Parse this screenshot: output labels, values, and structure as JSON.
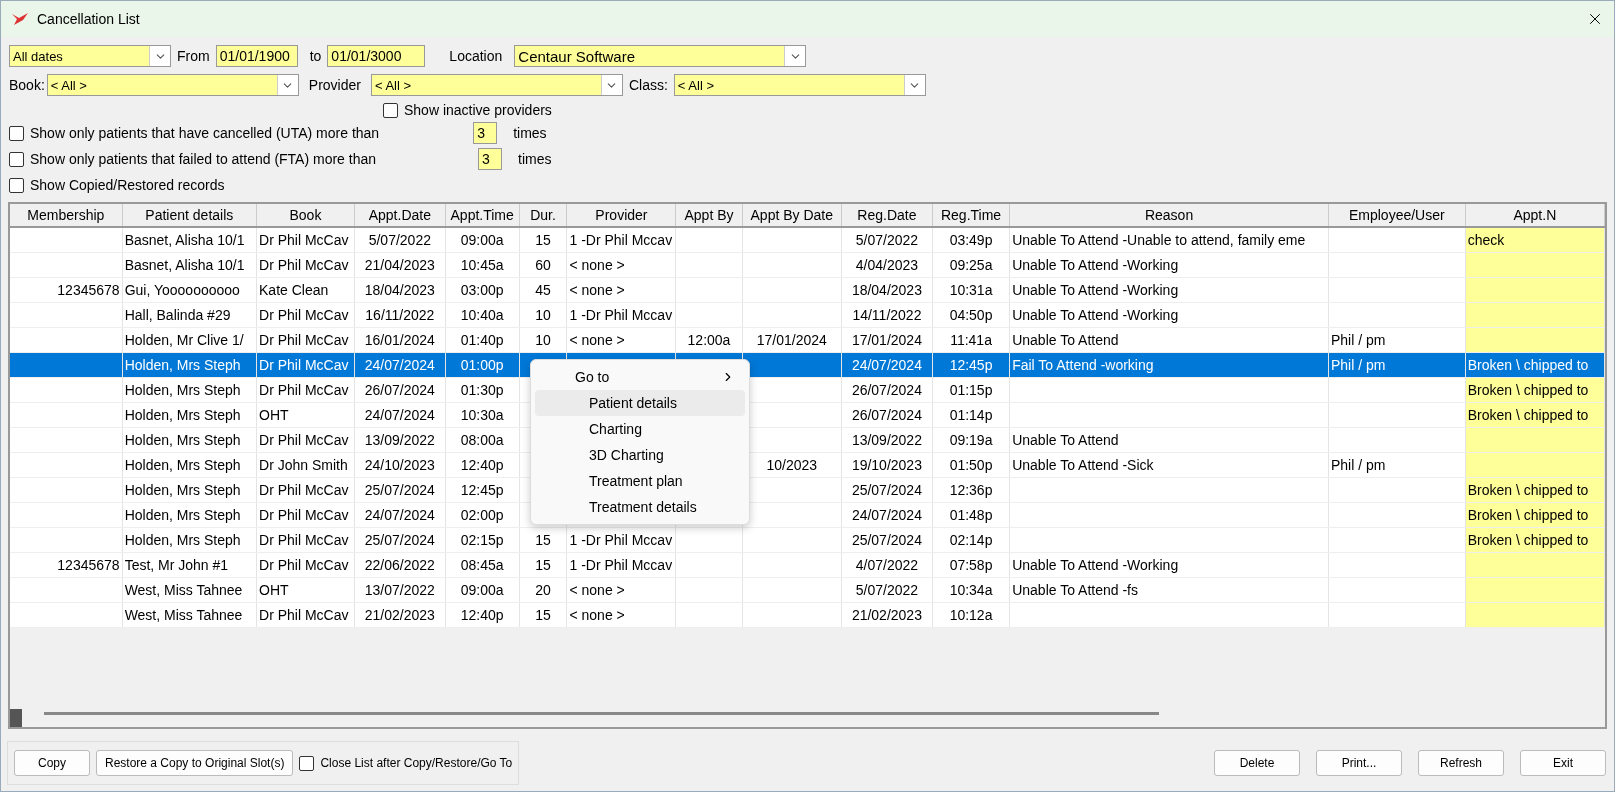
{
  "window": {
    "title": "Cancellation List"
  },
  "filters": {
    "date_range": {
      "value": "All dates"
    },
    "from_label": "From",
    "from": {
      "value": "01/01/1900"
    },
    "to_label": "to",
    "to": {
      "value": "01/01/3000"
    },
    "location_label": "Location",
    "location": {
      "value": "Centaur Software"
    },
    "book_label": "Book:",
    "book": {
      "value": "< All >"
    },
    "provider_label": "Provider",
    "provider": {
      "value": "< All >"
    },
    "class_label": "Class:",
    "class": {
      "value": "< All >"
    },
    "show_inactive": {
      "label": "Show inactive providers",
      "checked": false
    },
    "uta": {
      "label": "Show only patients that have cancelled (UTA) more than",
      "checked": false,
      "count": "3",
      "suffix": "times"
    },
    "fta": {
      "label": "Show only patients that failed to attend (FTA) more than",
      "checked": false,
      "count": "3",
      "suffix": "times"
    },
    "show_copied": {
      "label": "Show Copied/Restored records",
      "checked": false
    }
  },
  "table": {
    "columns": [
      "Membership",
      "Patient details",
      "Book",
      "Appt.Date",
      "Appt.Time",
      "Dur.",
      "Provider",
      "Appt By",
      "Appt By Date",
      "Reg.Date",
      "Reg.Time",
      "Reason",
      "Employee/User",
      "Appt.N"
    ],
    "rows": [
      {
        "selected": false,
        "cells": [
          null,
          "Basnet, Alisha 10/1",
          "Dr Phil McCav",
          "5/07/2022",
          "09:00a",
          "15",
          "1 -Dr Phil Mccav",
          null,
          null,
          "5/07/2022",
          "03:49p",
          "Unable To Attend -Unable to attend, family eme",
          null,
          "check"
        ]
      },
      {
        "selected": false,
        "cells": [
          null,
          "Basnet, Alisha 10/1",
          "Dr Phil McCav",
          "21/04/2023",
          "10:45a",
          "60",
          "< none >",
          null,
          null,
          "4/04/2023",
          "09:25a",
          "Unable To Attend -Working",
          null,
          null
        ]
      },
      {
        "selected": false,
        "cells": [
          "12345678",
          "Gui, Yoooooooooo",
          "Kate Clean",
          "18/04/2023",
          "03:00p",
          "45",
          "< none >",
          null,
          null,
          "18/04/2023",
          "10:31a",
          "Unable To Attend -Working",
          null,
          null
        ]
      },
      {
        "selected": false,
        "cells": [
          null,
          "Hall, Balinda #29",
          "Dr Phil McCav",
          "16/11/2022",
          "10:40a",
          "10",
          "1 -Dr Phil Mccav",
          null,
          null,
          "14/11/2022",
          "04:50p",
          "Unable To Attend -Working",
          null,
          null
        ]
      },
      {
        "selected": false,
        "cells": [
          null,
          "Holden, Mr Clive 1/",
          "Dr Phil McCav",
          "16/01/2024",
          "01:40p",
          "10",
          "< none >",
          "12:00a",
          "17/01/2024",
          "17/01/2024",
          "11:41a",
          "Unable To Attend",
          "Phil / pm",
          null
        ]
      },
      {
        "selected": true,
        "cells": [
          null,
          "Holden, Mrs Steph",
          "Dr Phil McCav",
          "24/07/2024",
          "01:00p",
          null,
          null,
          null,
          null,
          "24/07/2024",
          "12:45p",
          "Fail To Attend -working",
          "Phil / pm",
          "Broken \\ chipped to"
        ]
      },
      {
        "selected": false,
        "cells": [
          null,
          "Holden, Mrs Steph",
          "Dr Phil McCav",
          "26/07/2024",
          "01:30p",
          null,
          null,
          null,
          null,
          "26/07/2024",
          "01:15p",
          null,
          null,
          "Broken \\ chipped to"
        ]
      },
      {
        "selected": false,
        "cells": [
          null,
          "Holden, Mrs Steph",
          "OHT",
          "24/07/2024",
          "10:30a",
          null,
          null,
          null,
          null,
          "26/07/2024",
          "01:14p",
          null,
          null,
          "Broken \\ chipped to"
        ]
      },
      {
        "selected": false,
        "cells": [
          null,
          "Holden, Mrs Steph",
          "Dr Phil McCav",
          "13/09/2022",
          "08:00a",
          null,
          null,
          null,
          null,
          "13/09/2022",
          "09:19a",
          "Unable To Attend",
          null,
          null
        ]
      },
      {
        "selected": false,
        "cells": [
          null,
          "Holden, Mrs Steph",
          "Dr John Smith",
          "24/10/2023",
          "12:40p",
          null,
          null,
          null,
          "10/2023",
          "19/10/2023",
          "01:50p",
          "Unable To Attend -Sick",
          "Phil / pm",
          null
        ]
      },
      {
        "selected": false,
        "cells": [
          null,
          "Holden, Mrs Steph",
          "Dr Phil McCav",
          "25/07/2024",
          "12:45p",
          null,
          null,
          null,
          null,
          "25/07/2024",
          "12:36p",
          null,
          null,
          "Broken \\ chipped to"
        ]
      },
      {
        "selected": false,
        "cells": [
          null,
          "Holden, Mrs Steph",
          "Dr Phil McCav",
          "24/07/2024",
          "02:00p",
          null,
          null,
          null,
          null,
          "24/07/2024",
          "01:48p",
          null,
          null,
          "Broken \\ chipped to"
        ]
      },
      {
        "selected": false,
        "cells": [
          null,
          "Holden, Mrs Steph",
          "Dr Phil McCav",
          "25/07/2024",
          "02:15p",
          "15",
          "1 -Dr Phil Mccav",
          null,
          null,
          "25/07/2024",
          "02:14p",
          null,
          null,
          "Broken \\ chipped to"
        ]
      },
      {
        "selected": false,
        "cells": [
          "12345678",
          "Test, Mr John #1",
          "Dr Phil McCav",
          "22/06/2022",
          "08:45a",
          "15",
          "1 -Dr Phil Mccav",
          null,
          null,
          "4/07/2022",
          "07:58p",
          "Unable To Attend -Working",
          null,
          null
        ]
      },
      {
        "selected": false,
        "cells": [
          null,
          "West, Miss Tahnee",
          "OHT",
          "13/07/2022",
          "09:00a",
          "20",
          "< none >",
          null,
          null,
          "5/07/2022",
          "10:34a",
          "Unable To Attend -fs",
          null,
          null
        ]
      },
      {
        "selected": false,
        "cells": [
          null,
          "West, Miss Tahnee",
          "Dr Phil McCav",
          "21/02/2023",
          "12:40p",
          "15",
          "< none >",
          null,
          null,
          "21/02/2023",
          "10:12a",
          null,
          null,
          null
        ]
      }
    ]
  },
  "context_menu": {
    "items": [
      {
        "label": "Go to",
        "kind": "submenu",
        "selected": false
      },
      {
        "label": "Patient details",
        "kind": "item",
        "selected": true
      },
      {
        "label": "Charting",
        "kind": "item",
        "selected": false
      },
      {
        "label": "3D Charting",
        "kind": "item",
        "selected": false
      },
      {
        "label": "Treatment plan",
        "kind": "item",
        "selected": false
      },
      {
        "label": "Treatment details",
        "kind": "item",
        "selected": false
      }
    ]
  },
  "bottom": {
    "copy": "Copy",
    "restore": "Restore a Copy to Original Slot(s)",
    "close_after": {
      "label": "Close List after Copy/Restore/Go To",
      "checked": false
    },
    "buttons": [
      "Delete",
      "Print...",
      "Refresh",
      "Exit"
    ]
  }
}
